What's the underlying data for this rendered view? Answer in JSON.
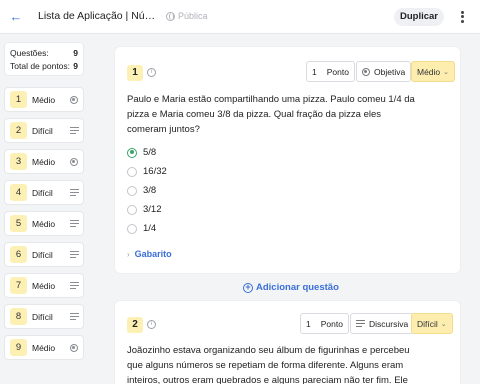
{
  "header": {
    "title": "Lista de Aplicação | Númer...",
    "visibility": "Pública",
    "duplicate_label": "Duplicar"
  },
  "summary": {
    "questions_label": "Questões:",
    "questions_value": "9",
    "points_label": "Total de pontos:",
    "points_value": "9"
  },
  "sidebar": {
    "items": [
      {
        "number": "1",
        "difficulty": "Médio",
        "type_icon": "radio-icon"
      },
      {
        "number": "2",
        "difficulty": "Difícil",
        "type_icon": "lines-icon"
      },
      {
        "number": "3",
        "difficulty": "Médio",
        "type_icon": "radio-icon"
      },
      {
        "number": "4",
        "difficulty": "Difícil",
        "type_icon": "lines-icon"
      },
      {
        "number": "5",
        "difficulty": "Médio",
        "type_icon": "lines-icon"
      },
      {
        "number": "6",
        "difficulty": "Difícil",
        "type_icon": "lines-icon"
      },
      {
        "number": "7",
        "difficulty": "Médio",
        "type_icon": "lines-icon"
      },
      {
        "number": "8",
        "difficulty": "Difícil",
        "type_icon": "lines-icon"
      },
      {
        "number": "9",
        "difficulty": "Médio",
        "type_icon": "radio-icon"
      }
    ]
  },
  "question1": {
    "number": "1",
    "points_value": "1",
    "points_label": "Ponto",
    "type": "Objetiva",
    "difficulty": "Médio",
    "text": "Paulo e Maria estão compartilhando uma pizza. Paulo comeu 1/4 da pizza e Maria comeu 3/8 da pizza. Qual fração da pizza eles comeram juntos?",
    "options": [
      "5/8",
      "16/32",
      "3/8",
      "3/12",
      "1/4"
    ],
    "answer_key_label": "Gabarito"
  },
  "add_question_label": "Adicionar questão",
  "question2": {
    "number": "2",
    "points_value": "1",
    "points_label": "Ponto",
    "type": "Discursiva",
    "difficulty": "Difícil",
    "text": "Joãozinho estava organizando seu álbum de figurinhas e percebeu que alguns números se repetiam de forma diferente. Alguns eram inteiros, outros eram quebrados e alguns pareciam não ter fim. Ele ficou"
  }
}
